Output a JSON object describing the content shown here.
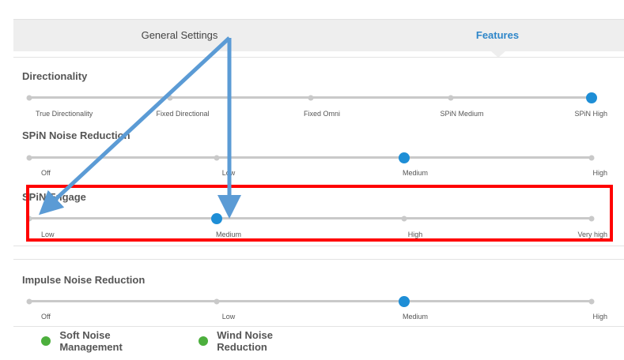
{
  "tabs": {
    "general": "General Settings",
    "features": "Features"
  },
  "directionality": {
    "title": "Directionality",
    "options": [
      "True Directionality",
      "Fixed Directional",
      "Fixed Omni",
      "SPiN Medium",
      "SPiN High"
    ],
    "selected_index": 4
  },
  "spin_noise_reduction": {
    "title": "SPiN Noise Reduction",
    "options": [
      "Off",
      "Low",
      "Medium",
      "High"
    ],
    "selected_index": 2
  },
  "spin_engage": {
    "title": "SPiN Engage",
    "options": [
      "Low",
      "Medium",
      "High",
      "Very high"
    ],
    "selected_index": 1
  },
  "impulse_noise_reduction": {
    "title": "Impulse Noise Reduction",
    "options": [
      "Off",
      "Low",
      "Medium",
      "High"
    ],
    "selected_index": 2
  },
  "toggles": {
    "soft_noise_management": {
      "label": "Soft Noise Management",
      "on": true
    },
    "wind_noise_reduction": {
      "label": "Wind Noise Reduction",
      "on": true
    }
  },
  "annotations": {
    "highlight_color": "#ff0000",
    "arrow_color": "#5b9bd5"
  },
  "colors": {
    "accent": "#1e8ed6",
    "tab_active": "#2e86c9",
    "toggle_on": "#4caf3d"
  }
}
